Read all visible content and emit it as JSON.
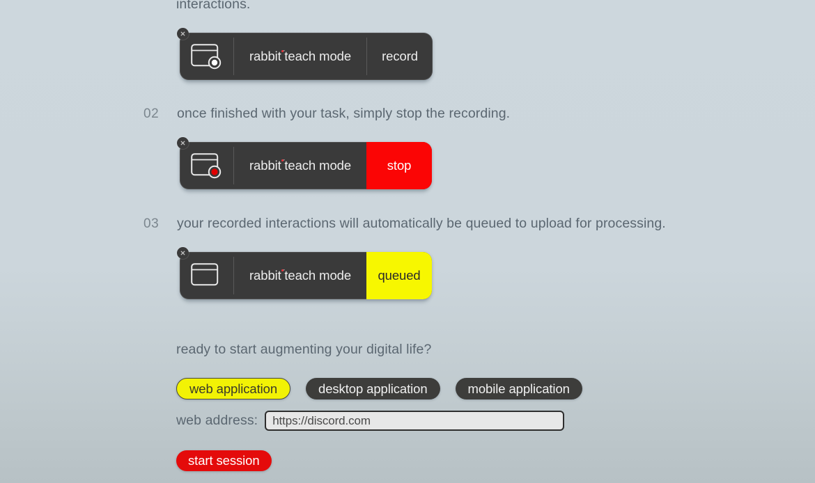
{
  "intro": {
    "clipped_text": "interactions."
  },
  "brand": {
    "name": "rabbit",
    "trademark": "˜",
    "product": " teach mode"
  },
  "steps": [
    {
      "number": "02",
      "text": "once finished with your task, simply stop the recording."
    },
    {
      "number": "03",
      "text": "your recorded interactions will automatically be queued to upload for processing."
    }
  ],
  "badges": [
    {
      "id": "record",
      "action_label": "record",
      "action_style": "neutral",
      "icon": "browser-window-record-icon",
      "dot_color": "#ffffff",
      "close_label": "×"
    },
    {
      "id": "stop",
      "action_label": "stop",
      "action_style": "danger",
      "icon": "browser-window-recording-icon",
      "dot_color": "#e00000",
      "close_label": "×"
    },
    {
      "id": "queued",
      "action_label": "queued",
      "action_style": "warn",
      "icon": "browser-window-icon",
      "dot_color": "none",
      "close_label": "×"
    }
  ],
  "footer": {
    "prompt": "ready to start augmenting your digital life?",
    "app_types": [
      {
        "label": "web application",
        "selected": true
      },
      {
        "label": "desktop application",
        "selected": false
      },
      {
        "label": "mobile application",
        "selected": false
      }
    ],
    "address_label": "web address:",
    "address_value": "https://discord.com",
    "address_placeholder": "https://",
    "start_label": "start session"
  },
  "colors": {
    "accent_yellow": "#f2f205",
    "accent_red": "#e40b0b",
    "stop_red": "#fb0505",
    "queued_yellow": "#f7f700",
    "badge_dark": "#3a3a3a",
    "background_top": "#cdd7dd",
    "background_bottom": "#b7c1c5",
    "brand_dot_red": "#e8333a"
  }
}
